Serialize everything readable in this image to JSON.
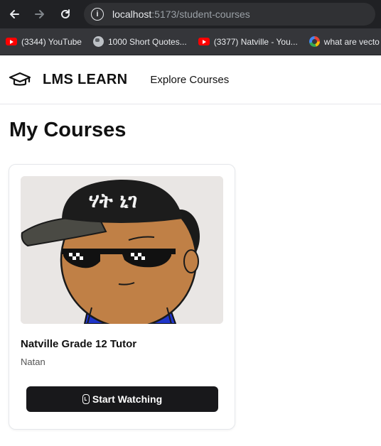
{
  "browser": {
    "url_host": "localhost",
    "url_rest": ":5173/student-courses",
    "bookmarks": [
      {
        "icon": "youtube-icon",
        "label": "(3344) YouTube"
      },
      {
        "icon": "globe-icon",
        "label": "1000 Short Quotes..."
      },
      {
        "icon": "youtube-icon",
        "label": "(3377) Natville - You..."
      },
      {
        "icon": "google-icon",
        "label": "what are vecto"
      }
    ]
  },
  "header": {
    "brand": "LMS LEARN",
    "nav_explore": "Explore Courses"
  },
  "page": {
    "title": "My Courses"
  },
  "courses": [
    {
      "title": "Natville Grade 12 Tutor",
      "author": "Natan",
      "button": "Start Watching",
      "cap_text": "ሃት ኒገ"
    }
  ],
  "colors": {
    "button_bg": "#18181b",
    "chrome_bg": "#202124",
    "bookmark_bar_bg": "#35363a"
  }
}
